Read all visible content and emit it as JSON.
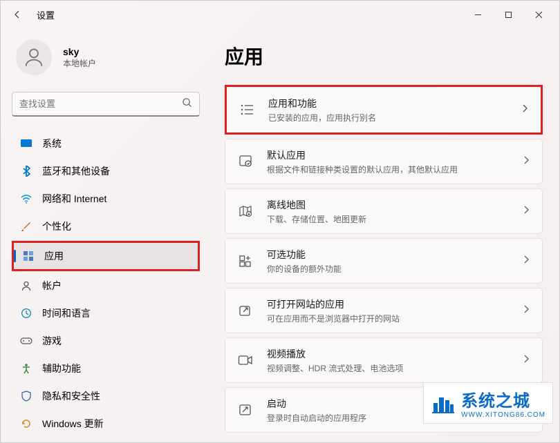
{
  "window": {
    "title": "设置"
  },
  "user": {
    "name": "sky",
    "subtitle": "本地帐户"
  },
  "search": {
    "placeholder": "查找设置"
  },
  "nav": {
    "system": "系统",
    "bluetooth": "蓝牙和其他设备",
    "network": "网络和 Internet",
    "personalization": "个性化",
    "apps": "应用",
    "accounts": "帐户",
    "time": "时间和语言",
    "gaming": "游戏",
    "accessibility": "辅助功能",
    "privacy": "隐私和安全性",
    "update": "Windows 更新"
  },
  "page": {
    "title": "应用"
  },
  "cards": {
    "apps_features": {
      "title": "应用和功能",
      "desc": "已安装的应用，应用执行别名"
    },
    "default_apps": {
      "title": "默认应用",
      "desc": "根据文件和链接种类设置的默认应用，其他默认应用"
    },
    "offline_maps": {
      "title": "离线地图",
      "desc": "下载、存储位置、地图更新"
    },
    "optional": {
      "title": "可选功能",
      "desc": "你的设备的额外功能"
    },
    "websites": {
      "title": "可打开网站的应用",
      "desc": "可在应用而不是浏览器中打开的网站"
    },
    "video": {
      "title": "视频播放",
      "desc": "视频调整、HDR 流式处理、电池选项"
    },
    "startup": {
      "title": "启动",
      "desc": "登录时自动启动的应用程序"
    }
  },
  "watermark": {
    "text": "系统之城",
    "url": "WWW.XITONG86.COM"
  }
}
